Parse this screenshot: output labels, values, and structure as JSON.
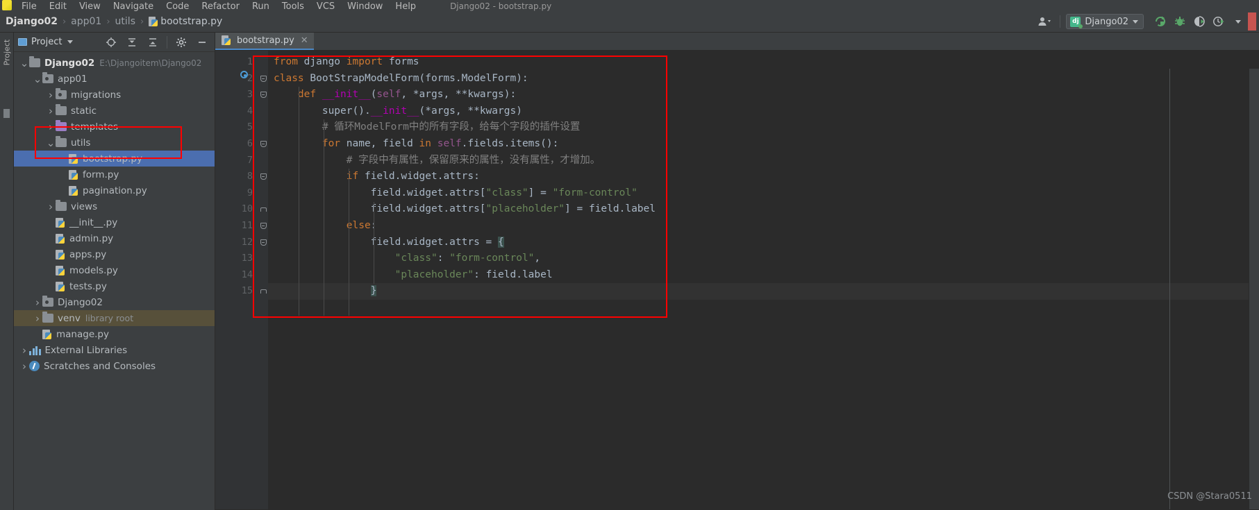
{
  "window": {
    "title": "Django02 - bootstrap.py",
    "menu": [
      "File",
      "Edit",
      "View",
      "Navigate",
      "Code",
      "Refactor",
      "Run",
      "Tools",
      "VCS",
      "Window",
      "Help"
    ]
  },
  "breadcrumb": {
    "items": [
      "Django02",
      "app01",
      "utils",
      "bootstrap.py"
    ],
    "separator": "›"
  },
  "toolbar": {
    "user_icon": "user-icon",
    "run_config": "Django02",
    "run_config_icon": "dj",
    "run_icon": "run-icon",
    "debug_icon": "debug-bug-icon",
    "coverage_icon": "run-with-coverage-icon",
    "profile_icon": "profile-icon",
    "more_icon": "chevron-down-icon",
    "search_icon": "search-icon"
  },
  "project_panel": {
    "title": "Project",
    "dropdown_icon": "chevron-down-icon",
    "actions": [
      "locate-icon",
      "expand-all-icon",
      "collapse-all-icon",
      "settings-gear-icon",
      "hide-icon"
    ],
    "tool_window_label": "Project",
    "tree": [
      {
        "label": "Django02",
        "detail": "E:\\Djangoitem\\Django02",
        "type": "folder",
        "indent": 0,
        "arrow": "expanded",
        "bold": true
      },
      {
        "label": "app01",
        "detail": "",
        "type": "folder-source",
        "indent": 1,
        "arrow": "expanded",
        "bold": false
      },
      {
        "label": "migrations",
        "detail": "",
        "type": "folder-source",
        "indent": 2,
        "arrow": "collapsed",
        "bold": false
      },
      {
        "label": "static",
        "detail": "",
        "type": "folder",
        "indent": 2,
        "arrow": "collapsed",
        "bold": false
      },
      {
        "label": "templates",
        "detail": "",
        "type": "folder-purple",
        "indent": 2,
        "arrow": "collapsed",
        "bold": false
      },
      {
        "label": "utils",
        "detail": "",
        "type": "folder",
        "indent": 2,
        "arrow": "expanded",
        "bold": false
      },
      {
        "label": "bootstrap.py",
        "detail": "",
        "type": "python-file",
        "indent": 3,
        "arrow": "none",
        "bold": false,
        "selected": true
      },
      {
        "label": "form.py",
        "detail": "",
        "type": "python-file",
        "indent": 3,
        "arrow": "none",
        "bold": false
      },
      {
        "label": "pagination.py",
        "detail": "",
        "type": "python-file",
        "indent": 3,
        "arrow": "none",
        "bold": false
      },
      {
        "label": "views",
        "detail": "",
        "type": "folder",
        "indent": 2,
        "arrow": "collapsed",
        "bold": false
      },
      {
        "label": "__init__.py",
        "detail": "",
        "type": "python-file",
        "indent": 2,
        "arrow": "none",
        "bold": false
      },
      {
        "label": "admin.py",
        "detail": "",
        "type": "python-file",
        "indent": 2,
        "arrow": "none",
        "bold": false
      },
      {
        "label": "apps.py",
        "detail": "",
        "type": "python-file",
        "indent": 2,
        "arrow": "none",
        "bold": false
      },
      {
        "label": "models.py",
        "detail": "",
        "type": "python-file",
        "indent": 2,
        "arrow": "none",
        "bold": false
      },
      {
        "label": "tests.py",
        "detail": "",
        "type": "python-file",
        "indent": 2,
        "arrow": "none",
        "bold": false
      },
      {
        "label": "Django02",
        "detail": "",
        "type": "folder-source",
        "indent": 1,
        "arrow": "collapsed",
        "bold": false
      },
      {
        "label": "venv",
        "detail": "library root",
        "type": "folder",
        "indent": 1,
        "arrow": "collapsed",
        "bold": false,
        "venv": true
      },
      {
        "label": "manage.py",
        "detail": "",
        "type": "python-file",
        "indent": 1,
        "arrow": "none",
        "bold": false
      },
      {
        "label": "External Libraries",
        "detail": "",
        "type": "libraries",
        "indent": 0,
        "arrow": "collapsed",
        "bold": false
      },
      {
        "label": "Scratches and Consoles",
        "detail": "",
        "type": "scratches",
        "indent": 0,
        "arrow": "collapsed",
        "bold": false
      }
    ]
  },
  "editor": {
    "tab": {
      "label": "bootstrap.py",
      "icon": "python-file-icon",
      "close_icon": "close-icon"
    },
    "bookmark_icon": "breakpoint-marker-icon",
    "lines": [
      {
        "n": "1",
        "tokens": [
          {
            "t": "from ",
            "c": "kw"
          },
          {
            "t": "django ",
            "c": "ident"
          },
          {
            "t": "import ",
            "c": "kw"
          },
          {
            "t": "forms",
            "c": "ident"
          }
        ]
      },
      {
        "n": "2",
        "tokens": [
          {
            "t": "class ",
            "c": "kw"
          },
          {
            "t": "BootStrapModelForm",
            "c": "cls"
          },
          {
            "t": "(forms.ModelForm):",
            "c": "ident"
          }
        ]
      },
      {
        "n": "3",
        "tokens": [
          {
            "t": "    ",
            "c": "ident"
          },
          {
            "t": "def ",
            "c": "kw"
          },
          {
            "t": "__init__",
            "c": "fn"
          },
          {
            "t": "(",
            "c": "ident"
          },
          {
            "t": "self",
            "c": "self"
          },
          {
            "t": ", *args, **kwargs):",
            "c": "ident"
          }
        ]
      },
      {
        "n": "4",
        "tokens": [
          {
            "t": "        super().",
            "c": "ident"
          },
          {
            "t": "__init__",
            "c": "fn"
          },
          {
            "t": "(*args, **kwargs)",
            "c": "ident"
          }
        ]
      },
      {
        "n": "5",
        "tokens": [
          {
            "t": "        # 循环ModelForm中的所有字段，给每个字段的插件设置",
            "c": "cmt"
          }
        ]
      },
      {
        "n": "6",
        "tokens": [
          {
            "t": "        ",
            "c": "ident"
          },
          {
            "t": "for ",
            "c": "kw"
          },
          {
            "t": "name, field ",
            "c": "ident"
          },
          {
            "t": "in ",
            "c": "kw"
          },
          {
            "t": "self",
            "c": "self"
          },
          {
            "t": ".fields.items():",
            "c": "ident"
          }
        ]
      },
      {
        "n": "7",
        "tokens": [
          {
            "t": "            # 字段中有属性，保留原来的属性，没有属性，才增加。",
            "c": "cmt"
          }
        ]
      },
      {
        "n": "8",
        "tokens": [
          {
            "t": "            ",
            "c": "ident"
          },
          {
            "t": "if ",
            "c": "kw"
          },
          {
            "t": "field.widget.attrs:",
            "c": "ident"
          }
        ]
      },
      {
        "n": "9",
        "tokens": [
          {
            "t": "                field.widget.attrs[",
            "c": "ident"
          },
          {
            "t": "\"class\"",
            "c": "str"
          },
          {
            "t": "] = ",
            "c": "ident"
          },
          {
            "t": "\"form-control\"",
            "c": "str"
          }
        ]
      },
      {
        "n": "10",
        "tokens": [
          {
            "t": "                field.widget.attrs[",
            "c": "ident"
          },
          {
            "t": "\"placeholder\"",
            "c": "str"
          },
          {
            "t": "] = field.label",
            "c": "ident"
          }
        ]
      },
      {
        "n": "11",
        "tokens": [
          {
            "t": "            ",
            "c": "ident"
          },
          {
            "t": "else",
            "c": "kw"
          },
          {
            "t": ":",
            "c": "ident"
          }
        ]
      },
      {
        "n": "12",
        "tokens": [
          {
            "t": "                field.widget.attrs = ",
            "c": "ident"
          },
          {
            "t": "{",
            "c": "brace"
          }
        ]
      },
      {
        "n": "13",
        "tokens": [
          {
            "t": "                    ",
            "c": "ident"
          },
          {
            "t": "\"class\"",
            "c": "str"
          },
          {
            "t": ": ",
            "c": "ident"
          },
          {
            "t": "\"form-control\"",
            "c": "str"
          },
          {
            "t": ",",
            "c": "ident"
          }
        ]
      },
      {
        "n": "14",
        "tokens": [
          {
            "t": "                    ",
            "c": "ident"
          },
          {
            "t": "\"placeholder\"",
            "c": "str"
          },
          {
            "t": ": field.label",
            "c": "ident"
          }
        ]
      },
      {
        "n": "15",
        "tokens": [
          {
            "t": "                ",
            "c": "ident"
          },
          {
            "t": "}",
            "c": "brace"
          }
        ]
      }
    ]
  },
  "annotations": {
    "color": "#ff0000",
    "boxes": [
      "project-tree-utils-bootstrap",
      "editor-code-region"
    ]
  },
  "watermark": "CSDN @Stara0511"
}
